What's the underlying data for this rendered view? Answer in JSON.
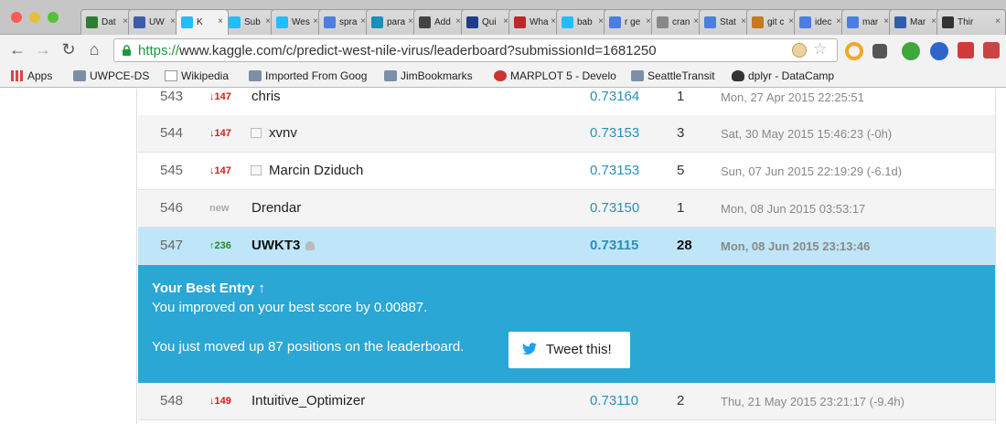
{
  "browser": {
    "tabs": [
      {
        "label": "Dat",
        "icon": "drive-icon",
        "color": "#2e7d32"
      },
      {
        "label": "UW",
        "icon": "uw-icon",
        "color": "#3b5da8"
      },
      {
        "label": "K",
        "icon": "kaggle-icon",
        "color": "#20beff",
        "active": true
      },
      {
        "label": "Sub",
        "icon": "kaggle-icon",
        "color": "#20beff"
      },
      {
        "label": "Wes",
        "icon": "kaggle-icon",
        "color": "#20beff"
      },
      {
        "label": "spra",
        "icon": "google-icon",
        "color": "#4a7fe0"
      },
      {
        "label": "para",
        "icon": "paren-icon",
        "color": "#1a8fb8"
      },
      {
        "label": "Add",
        "icon": "person-icon",
        "color": "#444"
      },
      {
        "label": "Qui",
        "icon": "r-icon",
        "color": "#1f3b8a"
      },
      {
        "label": "Wha",
        "icon": "quora-icon",
        "color": "#b92b27"
      },
      {
        "label": "bab",
        "icon": "kaggle-icon",
        "color": "#20beff"
      },
      {
        "label": "r ge",
        "icon": "google-icon",
        "color": "#4a7fe0"
      },
      {
        "label": "cran",
        "icon": "cran-icon",
        "color": "#888"
      },
      {
        "label": "Stat",
        "icon": "stat-icon",
        "color": "#4a7fe0"
      },
      {
        "label": "git c",
        "icon": "git-icon",
        "color": "#c47a1e"
      },
      {
        "label": "idec",
        "icon": "google-icon",
        "color": "#4a7fe0"
      },
      {
        "label": "mar",
        "icon": "google-icon",
        "color": "#4a7fe0"
      },
      {
        "label": "Mar",
        "icon": "window-icon",
        "color": "#2f5fa8"
      },
      {
        "label": "Thir",
        "icon": "r-icon",
        "color": "#333"
      }
    ],
    "tab_close": "×",
    "url_scheme": "https://",
    "url_rest": "www.kaggle.com/c/predict-west-nile-virus/leaderboard?submissionId=1681250",
    "bookmarks": [
      {
        "label": "Apps",
        "icon": "apps-icon"
      },
      {
        "label": "UWPCE-DS",
        "icon": "folder-icon"
      },
      {
        "label": "Wikipedia",
        "icon": "wikipedia-icon"
      },
      {
        "label": "Imported From Goog",
        "icon": "folder-icon"
      },
      {
        "label": "JimBookmarks",
        "icon": "folder-icon"
      },
      {
        "label": "MARPLOT 5 - Develo",
        "icon": "marplot-icon"
      },
      {
        "label": "SeattleTransit",
        "icon": "folder-icon"
      },
      {
        "label": "dplyr - DataCamp",
        "icon": "datacamp-icon"
      }
    ]
  },
  "leaderboard": {
    "rows": [
      {
        "rank": "543",
        "delta": "↓147",
        "dir": "down",
        "team": "chris",
        "chart_icon": false,
        "score": "0.73164",
        "entries": "1",
        "last": "Mon, 27 Apr 2015 22:25:51"
      },
      {
        "rank": "544",
        "delta": "↓147",
        "dir": "down",
        "team": "xvnv",
        "chart_icon": true,
        "score": "0.73153",
        "entries": "3",
        "last": "Sat, 30 May 2015 15:46:23 (-0h)"
      },
      {
        "rank": "545",
        "delta": "↓147",
        "dir": "down",
        "team": "Marcin Dziduch",
        "chart_icon": true,
        "score": "0.73153",
        "entries": "5",
        "last": "Sun, 07 Jun 2015 22:19:29 (-6.1d)"
      },
      {
        "rank": "546",
        "delta": "new",
        "dir": "new",
        "team": "Drendar",
        "chart_icon": false,
        "score": "0.73150",
        "entries": "1",
        "last": "Mon, 08 Jun 2015 03:53:17"
      },
      {
        "rank": "547",
        "delta": "↑236",
        "dir": "up",
        "team": "UWKT3",
        "chart_icon": false,
        "score": "0.73115",
        "entries": "28",
        "last": "Mon, 08 Jun 2015 23:13:46",
        "mine": true
      },
      {
        "rank": "548",
        "delta": "↓149",
        "dir": "down",
        "team": "Intuitive_Optimizer",
        "chart_icon": false,
        "score": "0.73110",
        "entries": "2",
        "last": "Thu, 21 May 2015 23:21:17 (-9.4h)"
      }
    ],
    "best_entry": {
      "title": "Your Best Entry ↑",
      "improved": "You improved on your best score by 0.00887.",
      "moved": "You just moved up 87 positions on the leaderboard.",
      "tweet_label": "Tweet this!"
    }
  },
  "colors": {
    "accent": "#2aa7d4",
    "highlight_row": "#bee6f8",
    "score": "#2b8fb8",
    "down": "#d01c1c",
    "up": "#2a8a2a"
  }
}
